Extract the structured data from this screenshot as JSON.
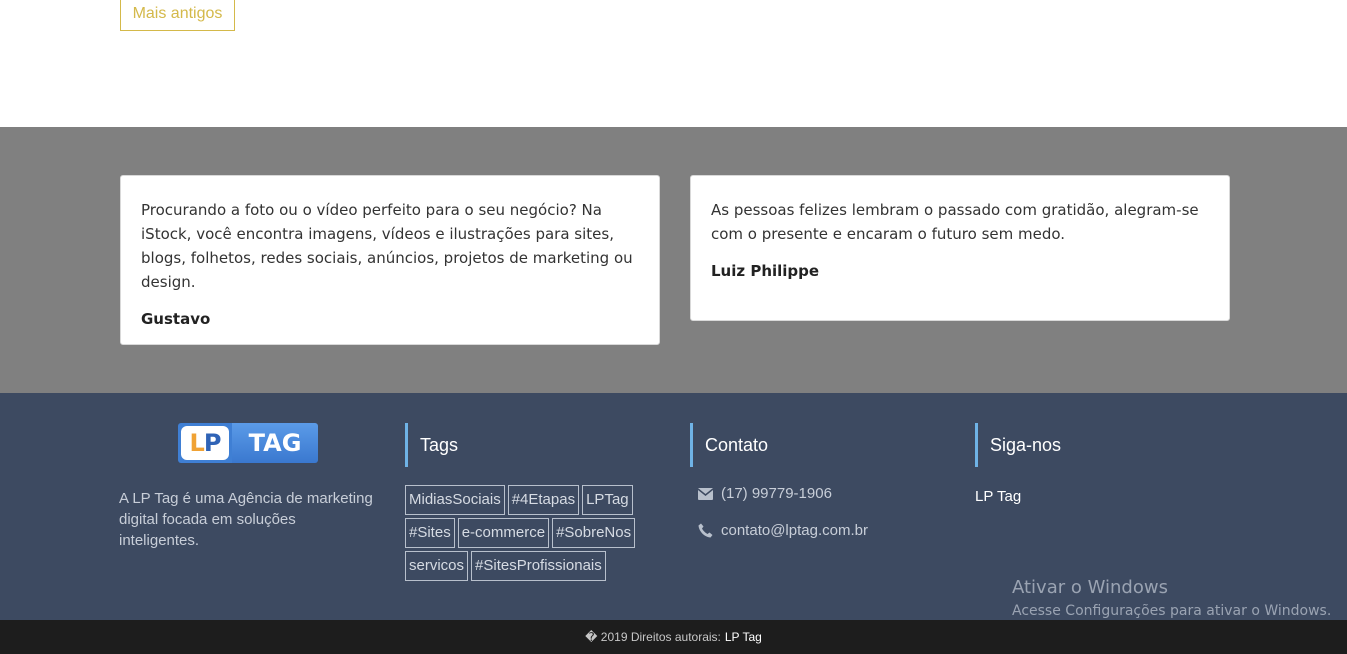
{
  "top": {
    "older_button": "Mais antigos"
  },
  "testimonials": [
    {
      "text": "Procurando a foto ou o vídeo perfeito para o seu negócio? Na iStock, você encontra imagens, vídeos e ilustrações para sites, blogs, folhetos, redes sociais, anúncios, projetos de marketing ou design.",
      "author": "Gustavo"
    },
    {
      "text": "As pessoas felizes lembram o passado com gratidão, alegram-se com o presente e encaram o futuro sem medo.",
      "author": "Luiz Philippe"
    }
  ],
  "footer": {
    "logo": {
      "lp": "LP",
      "tag": "TAG"
    },
    "about": "A LP Tag é uma Agência de marketing digital focada em soluções inteligentes.",
    "tags_heading": "Tags",
    "tags": [
      "MidiasSociais",
      "#4Etapas",
      "LPTag",
      "#Sites",
      "e-commerce",
      "#SobreNos",
      "servicos",
      "#SitesProfissionais"
    ],
    "contact_heading": "Contato",
    "phone": "(17) 99779-1906",
    "email": "contato@lptag.com.br",
    "follow_heading": "Siga-nos",
    "follow_link": "LP Tag"
  },
  "watermark": {
    "title": "Ativar o Windows",
    "subtitle": "Acesse Configurações para ativar o Windows."
  },
  "bottom_bar": {
    "copyright": "� 2019 Direitos autorais:",
    "brand": "LP Tag"
  },
  "colors": {
    "accent_gold": "#d4b94a",
    "footer_bg": "#3d4a61",
    "heading_bar": "#6fb3e6",
    "testimonial_bg": "#808080"
  }
}
